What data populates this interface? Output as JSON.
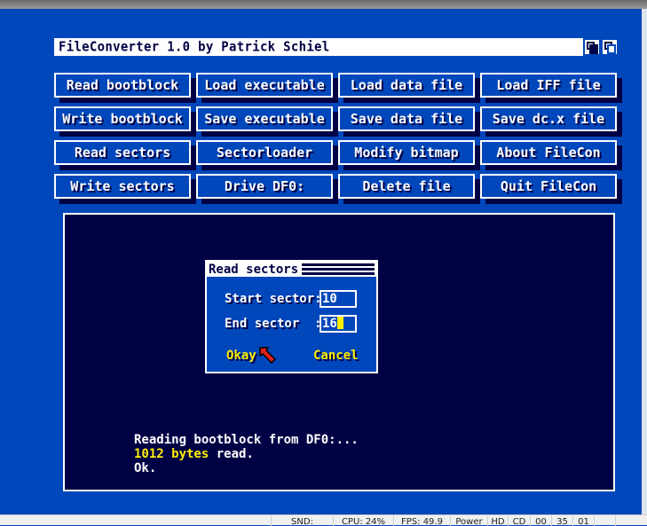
{
  "window": {
    "title": "FileConverter 1.0 by Patrick Schiel"
  },
  "buttons": [
    [
      "Read bootblock",
      "Load executable",
      "Load data file",
      "Load IFF file"
    ],
    [
      "Write bootblock",
      "Save executable",
      "Save data file",
      "Save dc.x file"
    ],
    [
      "Read sectors",
      "Sectorloader",
      "Modify bitmap",
      "About FileCon"
    ],
    [
      "Write sectors",
      "Drive DF0:",
      "Delete file",
      "Quit FileCon"
    ]
  ],
  "dialog": {
    "title": "Read sectors",
    "start_label": "Start sector:",
    "start_value": "10",
    "end_label": "End sector  :",
    "end_value": "16",
    "okay": "Okay",
    "cancel": "Cancel"
  },
  "output": {
    "line1": "Reading bootblock from DF0:...",
    "line2_count": "1012 bytes",
    "line2_rest": " read.",
    "line3": "Ok."
  },
  "statusbar": {
    "snd": "SND:",
    "cpu": "CPU: 24%",
    "fps": "FPS: 49.9",
    "power": "Power",
    "hd": "HD",
    "cd": "CD",
    "d0": "00",
    "d1": "35",
    "d2": "01"
  },
  "colors": {
    "blue": "#0047bb",
    "navy": "#000044",
    "yellow": "#ffee00"
  }
}
